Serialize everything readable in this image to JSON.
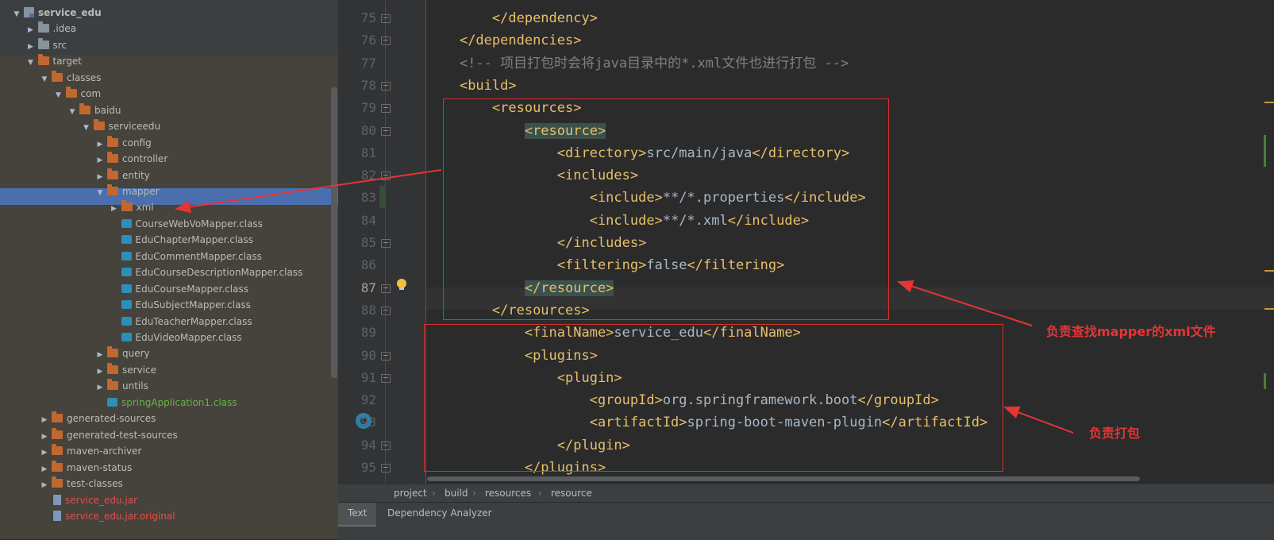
{
  "tree": {
    "items": [
      {
        "label": "service_edu",
        "icon": "module-icon",
        "expanded": true
      },
      {
        "label": ".idea",
        "icon": "folder-icon",
        "expanded": false
      },
      {
        "label": "src",
        "icon": "folder-icon",
        "expanded": false
      },
      {
        "label": "target",
        "icon": "folder-icon",
        "expanded": true
      },
      {
        "label": "classes",
        "icon": "folder-icon",
        "expanded": true
      },
      {
        "label": "com",
        "icon": "folder-icon",
        "expanded": true
      },
      {
        "label": "baidu",
        "icon": "folder-icon",
        "expanded": true
      },
      {
        "label": "serviceedu",
        "icon": "folder-icon",
        "expanded": true
      },
      {
        "label": "config",
        "icon": "folder-icon",
        "expanded": false
      },
      {
        "label": "controller",
        "icon": "folder-icon",
        "expanded": false
      },
      {
        "label": "entity",
        "icon": "folder-icon",
        "expanded": false
      },
      {
        "label": "mapper",
        "icon": "folder-icon",
        "expanded": true,
        "selected": true
      },
      {
        "label": "xml",
        "icon": "folder-icon",
        "expanded": false
      },
      {
        "label": "CourseWebVoMapper.class",
        "icon": "class-file-icon"
      },
      {
        "label": "EduChapterMapper.class",
        "icon": "class-file-icon"
      },
      {
        "label": "EduCommentMapper.class",
        "icon": "class-file-icon"
      },
      {
        "label": "EduCourseDescriptionMapper.class",
        "icon": "class-file-icon"
      },
      {
        "label": "EduCourseMapper.class",
        "icon": "class-file-icon"
      },
      {
        "label": "EduSubjectMapper.class",
        "icon": "class-file-icon"
      },
      {
        "label": "EduTeacherMapper.class",
        "icon": "class-file-icon"
      },
      {
        "label": "EduVideoMapper.class",
        "icon": "class-file-icon"
      },
      {
        "label": "query",
        "icon": "folder-icon",
        "expanded": false
      },
      {
        "label": "service",
        "icon": "folder-icon",
        "expanded": false
      },
      {
        "label": "untils",
        "icon": "folder-icon",
        "expanded": false
      },
      {
        "label": "springApplication1.class",
        "icon": "class-file-icon"
      },
      {
        "label": "generated-sources",
        "icon": "folder-icon",
        "expanded": false
      },
      {
        "label": "generated-test-sources",
        "icon": "folder-icon",
        "expanded": false
      },
      {
        "label": "maven-archiver",
        "icon": "folder-icon",
        "expanded": false
      },
      {
        "label": "maven-status",
        "icon": "folder-icon",
        "expanded": false
      },
      {
        "label": "test-classes",
        "icon": "folder-icon",
        "expanded": false
      },
      {
        "label": "service_edu.jar",
        "icon": "jar-icon"
      },
      {
        "label": "service_edu.jar.original",
        "icon": "jar-icon"
      }
    ]
  },
  "editor": {
    "line_numbers": [
      "75",
      "76",
      "77",
      "78",
      "79",
      "80",
      "81",
      "82",
      "83",
      "84",
      "85",
      "86",
      "87",
      "88",
      "89",
      "90",
      "91",
      "92",
      "93",
      "94",
      "95"
    ],
    "current_line": "87",
    "lines": [
      {
        "indent": "        ",
        "parts": [
          {
            "t": "</dependency>",
            "c": "tag"
          }
        ]
      },
      {
        "indent": "    ",
        "parts": [
          {
            "t": "</dependencies>",
            "c": "tag"
          }
        ]
      },
      {
        "indent": "    ",
        "parts": [
          {
            "t": "<!-- 项目打包时会将java目录中的*.xml文件也进行打包 -->",
            "c": "cmt"
          }
        ]
      },
      {
        "indent": "    ",
        "parts": [
          {
            "t": "<build>",
            "c": "tag"
          }
        ]
      },
      {
        "indent": "        ",
        "parts": [
          {
            "t": "<resources>",
            "c": "tag"
          }
        ]
      },
      {
        "indent": "            ",
        "parts": [
          {
            "t": "<resource>",
            "c": "tag hl"
          }
        ]
      },
      {
        "indent": "                ",
        "parts": [
          {
            "t": "<directory>",
            "c": "tag"
          },
          {
            "t": "src/main/java",
            "c": "txt"
          },
          {
            "t": "</directory>",
            "c": "tag"
          }
        ]
      },
      {
        "indent": "                ",
        "parts": [
          {
            "t": "<includes>",
            "c": "tag"
          }
        ]
      },
      {
        "indent": "                    ",
        "parts": [
          {
            "t": "<include>",
            "c": "tag"
          },
          {
            "t": "**/*.properties",
            "c": "txt"
          },
          {
            "t": "</include>",
            "c": "tag"
          }
        ]
      },
      {
        "indent": "                    ",
        "parts": [
          {
            "t": "<include>",
            "c": "tag"
          },
          {
            "t": "**/*.xml",
            "c": "txt"
          },
          {
            "t": "</include>",
            "c": "tag"
          }
        ]
      },
      {
        "indent": "                ",
        "parts": [
          {
            "t": "</includes>",
            "c": "tag"
          }
        ]
      },
      {
        "indent": "                ",
        "parts": [
          {
            "t": "<filtering>",
            "c": "tag"
          },
          {
            "t": "false",
            "c": "txt"
          },
          {
            "t": "</filtering>",
            "c": "tag"
          }
        ]
      },
      {
        "indent": "            ",
        "parts": [
          {
            "t": "</resource>",
            "c": "tag hl"
          }
        ]
      },
      {
        "indent": "        ",
        "parts": [
          {
            "t": "</resources>",
            "c": "tag"
          }
        ]
      },
      {
        "indent": "            ",
        "parts": [
          {
            "t": "<finalName>",
            "c": "tag"
          },
          {
            "t": "service_edu",
            "c": "txt"
          },
          {
            "t": "</finalName>",
            "c": "tag"
          }
        ]
      },
      {
        "indent": "            ",
        "parts": [
          {
            "t": "<plugins>",
            "c": "tag"
          }
        ]
      },
      {
        "indent": "                ",
        "parts": [
          {
            "t": "<plugin>",
            "c": "tag"
          }
        ]
      },
      {
        "indent": "                    ",
        "parts": [
          {
            "t": "<groupId>",
            "c": "tag"
          },
          {
            "t": "org.springframework.boot",
            "c": "txt"
          },
          {
            "t": "</groupId>",
            "c": "tag"
          }
        ]
      },
      {
        "indent": "                    ",
        "parts": [
          {
            "t": "<artifactId>",
            "c": "tag"
          },
          {
            "t": "spring-boot-maven-plugin",
            "c": "txt"
          },
          {
            "t": "</artifactId>",
            "c": "tag"
          }
        ]
      },
      {
        "indent": "                ",
        "parts": [
          {
            "t": "</plugin>",
            "c": "tag"
          }
        ]
      },
      {
        "indent": "            ",
        "parts": [
          {
            "t": "</plugins>",
            "c": "tag"
          }
        ]
      }
    ]
  },
  "breadcrumb": [
    "project",
    "build",
    "resources",
    "resource"
  ],
  "bottom_tabs": {
    "text": "Text",
    "analyzer": "Dependency Analyzer"
  },
  "annotations": {
    "mapper_note": "负责查找mapper的xml文件",
    "package_note": "负责打包"
  },
  "colors": {
    "annotation_red": "#e53535",
    "tag": "#e8bf6a",
    "comment": "#808080",
    "selection": "#4b6eaf"
  }
}
